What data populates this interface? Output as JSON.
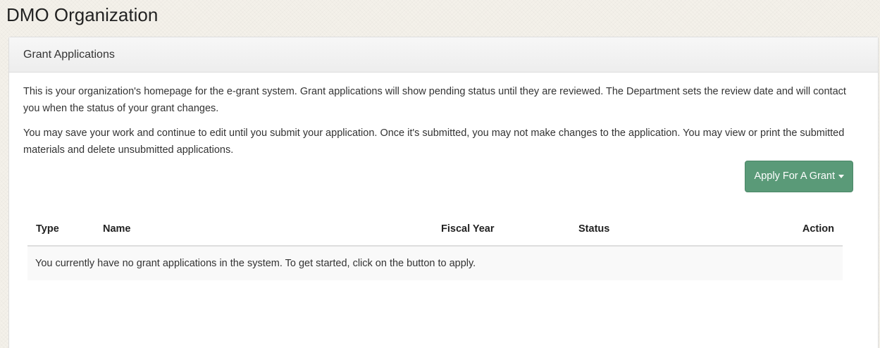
{
  "page": {
    "title": "DMO Organization"
  },
  "panel": {
    "heading": "Grant Applications",
    "paragraphs": [
      "This is your organization's homepage for the e-grant system. Grant applications will show pending status until they are reviewed. The Department sets the review date and will contact you when the status of your grant changes.",
      "You may save your work and continue to edit until you submit your application. Once it's submitted, you may not make changes to the application. You may view or print the submitted materials and delete unsubmitted applications."
    ],
    "apply_button_label": "Apply For A Grant",
    "apply_button_icon": "caret-down-icon",
    "colors": {
      "button_bg": "#5a9a78",
      "button_text": "#ffffff"
    }
  },
  "table": {
    "columns": [
      "Type",
      "Name",
      "Fiscal Year",
      "Status",
      "Action"
    ],
    "empty_message": "You currently have no grant applications in the system. To get started, click on the button to apply."
  }
}
